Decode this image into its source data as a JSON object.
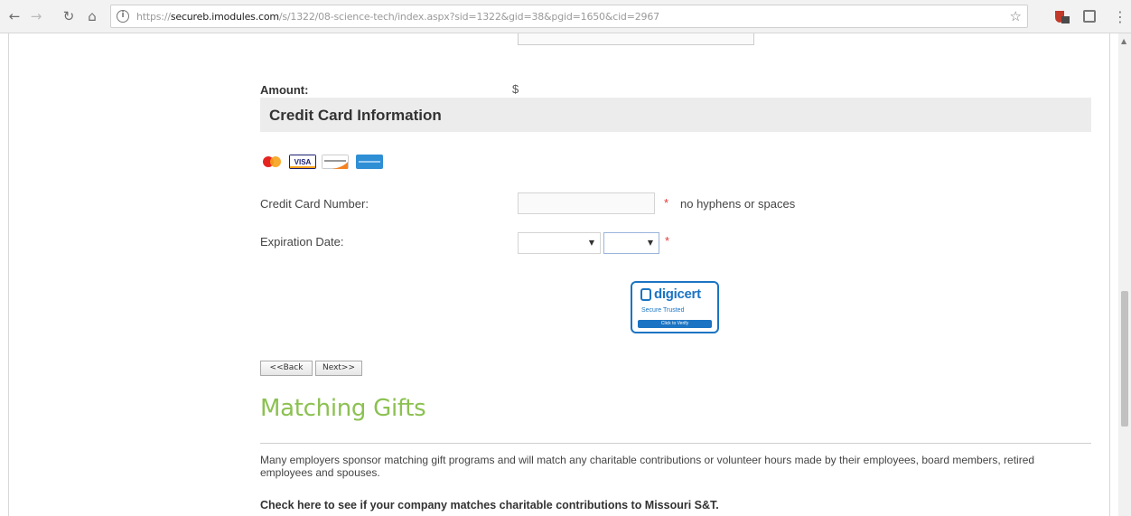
{
  "browser": {
    "url_prefix": "https://",
    "url_host": "secureb.imodules.com",
    "url_path": "/s/1322/08-science-tech/index.aspx?sid=1322&gid=38&pgid=1650&cid=2967"
  },
  "form": {
    "amount_label": "Amount:",
    "amount_value": "$",
    "section_title": "Credit Card Information",
    "card_logos": [
      "mastercard-logo",
      "visa-logo",
      "discover-logo",
      "amex-logo"
    ],
    "cc_number_label": "Credit Card Number:",
    "cc_number_value": "",
    "required_marker": "*",
    "cc_number_hint": "no hyphens or spaces",
    "expiration_label": "Expiration Date:",
    "exp_month_value": "",
    "exp_year_value": ""
  },
  "badge": {
    "brand": "digicert",
    "subtitle": "Secure  Trusted",
    "bar_text": "Click to Verify"
  },
  "buttons": {
    "back": "<<Back",
    "next": "Next>>"
  },
  "matching_gifts": {
    "title": "Matching Gifts",
    "paragraph": "Many employers sponsor matching gift programs and will match any charitable contributions or volunteer hours made by their employees, board members, retired employees and spouses.",
    "cta": "Check here to see if your company matches charitable contributions to Missouri S&T."
  },
  "colors": {
    "accent_green": "#8cc152",
    "required_red": "#e03a3a",
    "digicert_blue": "#1b74c3"
  }
}
